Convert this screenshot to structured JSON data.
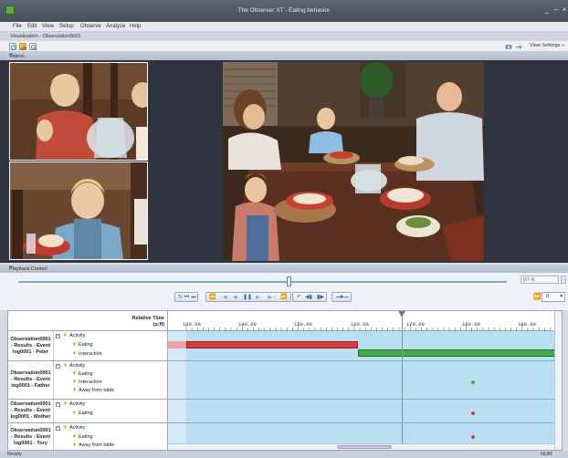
{
  "window": {
    "title": "The Observer XT - Eating behavior",
    "controls": [
      "_",
      "–",
      "×"
    ]
  },
  "menu": [
    "File",
    "Edit",
    "View",
    "Setup",
    "Observe",
    "Analyze",
    "Help"
  ],
  "document_tab": "Visualisation - Observation0001",
  "toolbar": {
    "icons": [
      "clock-icon",
      "chart-icon",
      "search-icon"
    ],
    "right_icons": [
      "camera-icon",
      "export-icon"
    ],
    "view_settings": "View Settings »"
  },
  "videos_panel": {
    "title": "Videos",
    "close": "×"
  },
  "playback_panel": {
    "title": "Playback Control",
    "close": "×",
    "time_value": "[67.4]",
    "speed_value": "0",
    "position_fraction": 0.55
  },
  "timeline": {
    "header_label": "Relative Time",
    "header_unit": "(s:ff)",
    "ticks": [
      "130.00",
      "140.00",
      "150.00",
      "160.00",
      "170.00",
      "180.00",
      "190.00"
    ],
    "rows": [
      {
        "observation": "Observation0001 - Results - Event log0001 - Peter",
        "group": "Activity",
        "behaviors": [
          "Eating",
          "Interaction"
        ],
        "colors": {
          "eating": "#e03a36",
          "interaction": "#3fae49"
        }
      },
      {
        "observation": "Observation0001 - Results - Event log0001 - Father",
        "group": "Activity",
        "behaviors": [
          "Eating",
          "Interaction",
          "Away from table"
        ],
        "dot_color": "#3fae49"
      },
      {
        "observation": "Observation0001 - Results - Event log0001 - Mother",
        "group": "Activity",
        "behaviors": [
          "Eating"
        ],
        "dot_color": "#e03a36"
      },
      {
        "observation": "Observation0001 - Results - Event log0001 - Tory",
        "group": "Activity",
        "behaviors": [
          "Eating",
          "Away from table"
        ],
        "dot_color": "#e03a36"
      }
    ]
  },
  "status": {
    "text": "Ready",
    "right": "NUM"
  }
}
